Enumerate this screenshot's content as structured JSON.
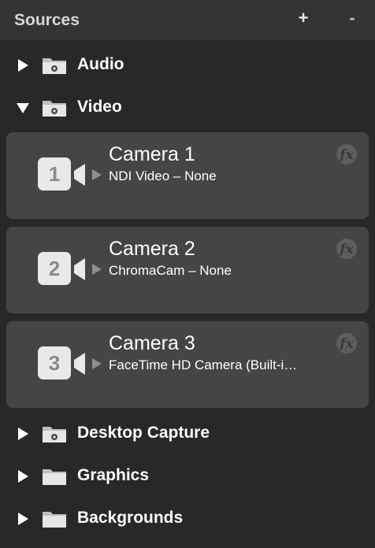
{
  "header": {
    "title": "Sources",
    "add_label": "+",
    "remove_label": "-"
  },
  "groups": [
    {
      "label": "Audio",
      "expanded": false,
      "icon": "gear-folder-icon"
    },
    {
      "label": "Video",
      "expanded": true,
      "icon": "gear-folder-icon"
    },
    {
      "label": "Desktop Capture",
      "expanded": false,
      "icon": "gear-folder-icon"
    },
    {
      "label": "Graphics",
      "expanded": false,
      "icon": "folder-icon"
    },
    {
      "label": "Backgrounds",
      "expanded": false,
      "icon": "folder-icon"
    }
  ],
  "sources": [
    {
      "number": "1",
      "title": "Camera 1",
      "subtitle": "NDI Video – None",
      "effect_label": "fx"
    },
    {
      "number": "2",
      "title": "Camera 2",
      "subtitle": "ChromaCam – None",
      "effect_label": "fx"
    },
    {
      "number": "3",
      "title": "Camera 3",
      "subtitle": "FaceTime HD Camera (Built-i…",
      "effect_label": "fx"
    }
  ],
  "colors": {
    "background": "#282828",
    "header": "#343434",
    "card": "#454545",
    "badge": "#e9e9e9"
  }
}
